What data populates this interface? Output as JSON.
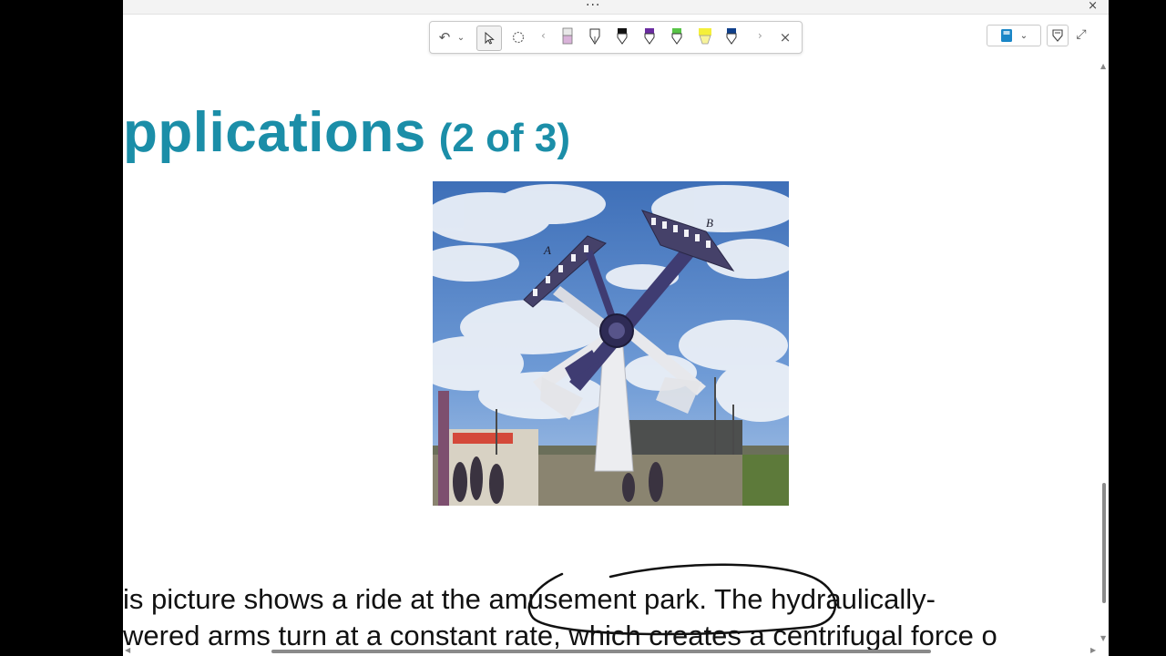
{
  "window": {
    "overflow_menu": "...",
    "close_glyph": "×"
  },
  "ink_toolbar": {
    "undo_glyph": "↶",
    "dropdown_glyph": "⌄",
    "prev_glyph": "‹",
    "next_glyph": "›",
    "close_glyph": "×",
    "pens": [
      {
        "name": "pencil-tool",
        "color": "#d9b3d9"
      },
      {
        "name": "pen-outline-tool",
        "color": "#ffffff"
      },
      {
        "name": "pen-black",
        "color": "#111111"
      },
      {
        "name": "pen-purple",
        "color": "#6a2ca0"
      },
      {
        "name": "pen-green",
        "color": "#58c447"
      },
      {
        "name": "highlighter-yellow",
        "color": "#f4ef3a"
      },
      {
        "name": "pen-navy",
        "color": "#0f3f8a"
      }
    ]
  },
  "right_controls": {
    "dropdown_glyph": "⌄",
    "expand_glyph": "⤢"
  },
  "slide": {
    "title_main": "pplications",
    "title_sub": "(2 of 3)",
    "body_line1_a": "is picture shows a ride at the ",
    "body_line1_b": "amusement park. The",
    "body_line1_c": " hydraulically-",
    "body_line2": "wered arms turn at a constant rate, which creates a centrifugal force o",
    "photo_label_a": "A",
    "photo_label_b": "B"
  },
  "colors": {
    "title": "#1b8ea8",
    "ink_circle": "#111111"
  }
}
